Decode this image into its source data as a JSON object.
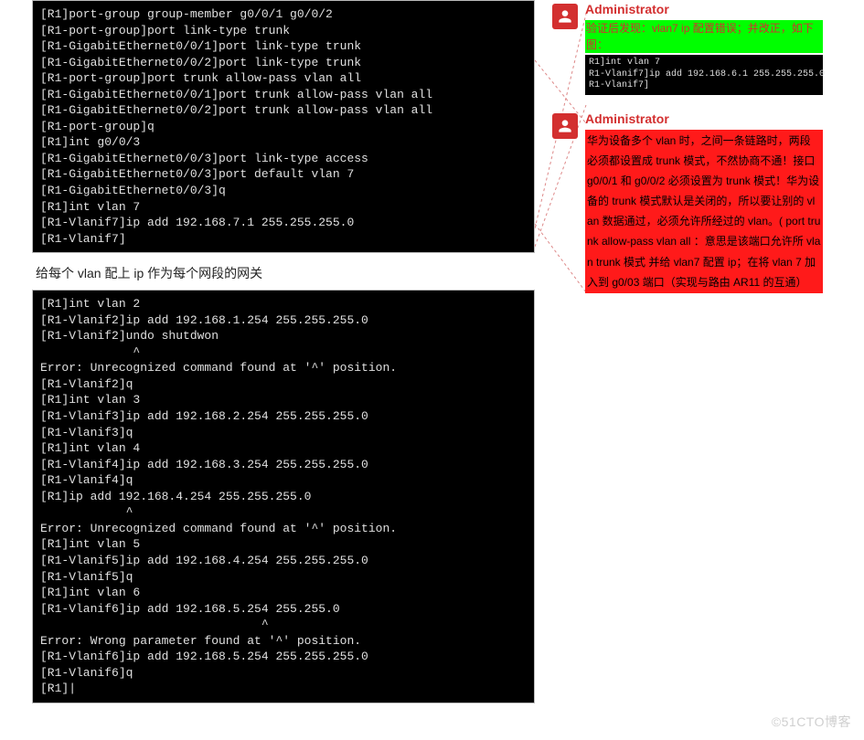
{
  "terminal1": "[R1]port-group group-member g0/0/1 g0/0/2\n[R1-port-group]port link-type trunk\n[R1-GigabitEthernet0/0/1]port link-type trunk\n[R1-GigabitEthernet0/0/2]port link-type trunk\n[R1-port-group]port trunk allow-pass vlan all\n[R1-GigabitEthernet0/0/1]port trunk allow-pass vlan all\n[R1-GigabitEthernet0/0/2]port trunk allow-pass vlan all\n[R1-port-group]q\n[R1]int g0/0/3\n[R1-GigabitEthernet0/0/3]port link-type access\n[R1-GigabitEthernet0/0/3]port default vlan 7\n[R1-GigabitEthernet0/0/3]q\n[R1]int vlan 7\n[R1-Vlanif7]ip add 192.168.7.1 255.255.255.0\n[R1-Vlanif7]",
  "caption": "给每个 vlan 配上 ip 作为每个网段的网关",
  "terminal2": "[R1]int vlan 2\n[R1-Vlanif2]ip add 192.168.1.254 255.255.255.0\n[R1-Vlanif2]undo shutdwon\n             ^\nError: Unrecognized command found at '^' position.\n[R1-Vlanif2]q\n[R1]int vlan 3\n[R1-Vlanif3]ip add 192.168.2.254 255.255.255.0\n[R1-Vlanif3]q\n[R1]int vlan 4\n[R1-Vlanif4]ip add 192.168.3.254 255.255.255.0\n[R1-Vlanif4]q\n[R1]ip add 192.168.4.254 255.255.255.0\n            ^\nError: Unrecognized command found at '^' position.\n[R1]int vlan 5\n[R1-Vlanif5]ip add 192.168.4.254 255.255.255.0\n[R1-Vlanif5]q\n[R1]int vlan 6\n[R1-Vlanif6]ip add 192.168.5.254 255.255.0\n                               ^\nError: Wrong parameter found at '^' position.\n[R1-Vlanif6]ip add 192.168.5.254 255.255.255.0\n[R1-Vlanif6]q\n[R1]|",
  "comments": [
    {
      "author": "Administrator",
      "green": "验证后发现：vlan7 ip 配置错误；并改正，如下图：",
      "code": "R1]int vlan 7\nR1-Vlanif7]ip add 192.168.6.1 255.255.255.0\nR1-Vlanif7]"
    },
    {
      "author": "Administrator",
      "red": "华为设备多个 vlan 时，之间一条链路时，两段必须都设置成 trunk 模式，不然协商不通！接口 g0/0/1 和 g0/0/2 必须设置为 trunk 模式！华为设备的 trunk 模式默认是关闭的，所以要让别的 vlan 数据通过，必须允许所经过的 vlan。( port trunk allow-pass vlan all  ：意思是该端口允许所 vlan   trunk 模式   并给 vlan7  配置 ip；在将 vlan 7 加入到 g0/03 端口（实现与路由 AR11 的互通）"
    }
  ],
  "watermark": "©51CTO博客"
}
